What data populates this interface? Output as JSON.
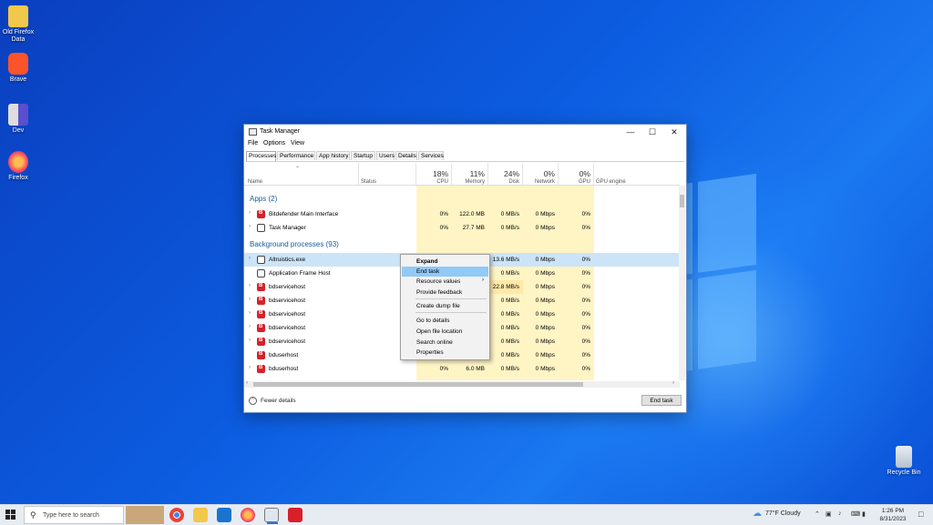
{
  "desktop": {
    "icons": [
      {
        "label": "Old Firefox Data"
      },
      {
        "label": "Brave"
      },
      {
        "label": "Dev"
      },
      {
        "label": "Firefox"
      },
      {
        "label": "Recycle Bin"
      }
    ]
  },
  "window": {
    "title": "Task Manager",
    "menu": [
      "File",
      "Options",
      "View"
    ],
    "tabs": [
      "Processes",
      "Performance",
      "App history",
      "Startup",
      "Users",
      "Details",
      "Services"
    ],
    "active_tab": "Processes"
  },
  "columns": {
    "name": "Name",
    "status": "Status",
    "cpu": {
      "pct": "18%",
      "label": "CPU"
    },
    "memory": {
      "pct": "11%",
      "label": "Memory"
    },
    "disk": {
      "pct": "24%",
      "label": "Disk"
    },
    "network": {
      "pct": "0%",
      "label": "Network"
    },
    "gpu": {
      "pct": "0%",
      "label": "GPU"
    },
    "gpu_engine": "GPU engine"
  },
  "groups": {
    "apps": "Apps (2)",
    "background": "Background processes (93)"
  },
  "apps": [
    {
      "name": "Bitdefender Main Interface",
      "cpu": "0%",
      "memory": "122.0 MB",
      "disk": "0 MB/s",
      "network": "0 Mbps",
      "gpu": "0%"
    },
    {
      "name": "Task Manager",
      "cpu": "0%",
      "memory": "27.7 MB",
      "disk": "0 MB/s",
      "network": "0 Mbps",
      "gpu": "0%"
    }
  ],
  "background": [
    {
      "name": "Altruistics.exe",
      "cpu": "",
      "memory": "",
      "disk": "13.6 MB/s",
      "network": "0 Mbps",
      "gpu": "0%"
    },
    {
      "name": "Application Frame Host",
      "cpu": "",
      "memory": "",
      "disk": "0 MB/s",
      "network": "0 Mbps",
      "gpu": "0%"
    },
    {
      "name": "bdservicehost",
      "cpu": "",
      "memory": "",
      "disk": "22.8 MB/s",
      "network": "0 Mbps",
      "gpu": "0%"
    },
    {
      "name": "bdservicehost",
      "cpu": "",
      "memory": "",
      "disk": "0 MB/s",
      "network": "0 Mbps",
      "gpu": "0%"
    },
    {
      "name": "bdservicehost",
      "cpu": "",
      "memory": "",
      "disk": "0 MB/s",
      "network": "0 Mbps",
      "gpu": "0%"
    },
    {
      "name": "bdservicehost",
      "cpu": "",
      "memory": "",
      "disk": "0 MB/s",
      "network": "0 Mbps",
      "gpu": "0%"
    },
    {
      "name": "bdservicehost",
      "cpu": "",
      "memory": "",
      "disk": "0 MB/s",
      "network": "0 Mbps",
      "gpu": "0%"
    },
    {
      "name": "bduserhost",
      "cpu": "",
      "memory": "",
      "disk": "0 MB/s",
      "network": "0 Mbps",
      "gpu": "0%"
    },
    {
      "name": "bduserhost",
      "cpu": "0%",
      "memory": "6.0 MB",
      "disk": "0 MB/s",
      "network": "0 Mbps",
      "gpu": "0%"
    }
  ],
  "context_menu": {
    "items": [
      "Expand",
      "End task",
      "Resource values",
      "Provide feedback",
      "Create dump file",
      "Go to details",
      "Open file location",
      "Search online",
      "Properties"
    ]
  },
  "footer": {
    "fewer_details": "Fewer details",
    "end_task": "End task"
  },
  "taskbar": {
    "search_placeholder": "Type here to search",
    "weather": "77°F  Cloudy",
    "time": "1:26 PM",
    "date": "8/31/2023"
  },
  "colors": {
    "accent": "#0078d7",
    "cell_highlight": "#fff4c4",
    "cell_highlight_strong": "#ffe9a8",
    "selected_row": "#cce4f7",
    "bitdefender_red": "#d8202a"
  }
}
